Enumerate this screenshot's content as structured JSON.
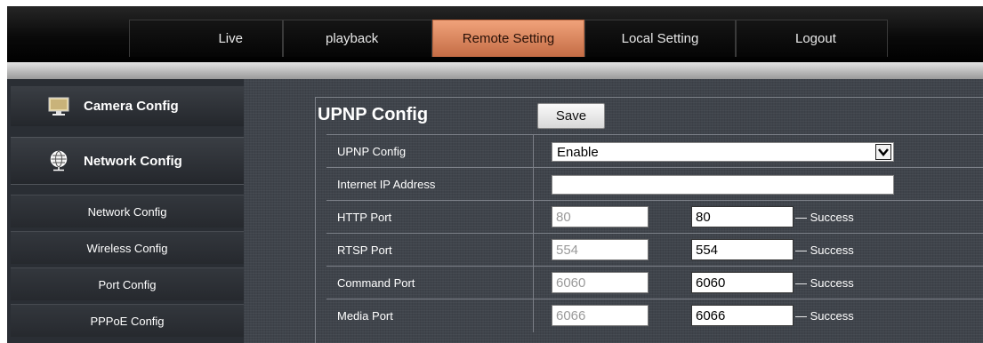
{
  "nav": {
    "items": [
      {
        "label": "Live",
        "active": false
      },
      {
        "label": "playback",
        "active": false
      },
      {
        "label": "Remote Setting",
        "active": true
      },
      {
        "label": "Local Setting",
        "active": false
      },
      {
        "label": "Logout",
        "active": false
      }
    ]
  },
  "sidebar": {
    "camera_config": {
      "label": "Camera Config",
      "icon": "monitor-icon"
    },
    "network_config": {
      "label": "Network Config",
      "icon": "globe-icon"
    },
    "sub_items": [
      {
        "label": "Network Config"
      },
      {
        "label": "Wireless Config"
      },
      {
        "label": "Port Config"
      },
      {
        "label": "PPPoE Config"
      }
    ]
  },
  "panel": {
    "title": "UPNP Config",
    "save_label": "Save",
    "upnp_row": {
      "label": "UPNP Config",
      "selected": "Enable"
    },
    "ip_row": {
      "label": "Internet IP Address",
      "value": ""
    },
    "ports": [
      {
        "label": "HTTP Port",
        "local": "80",
        "external": "80",
        "status": "— Success"
      },
      {
        "label": "RTSP Port",
        "local": "554",
        "external": "554",
        "status": "— Success"
      },
      {
        "label": "Command Port",
        "local": "6060",
        "external": "6060",
        "status": "— Success"
      },
      {
        "label": "Media Port",
        "local": "6066",
        "external": "6066",
        "status": "— Success"
      }
    ]
  },
  "colors": {
    "active_tab": "#d9825a",
    "sidebar_bg": "#2a2e34",
    "main_bg": "#3f444b"
  }
}
